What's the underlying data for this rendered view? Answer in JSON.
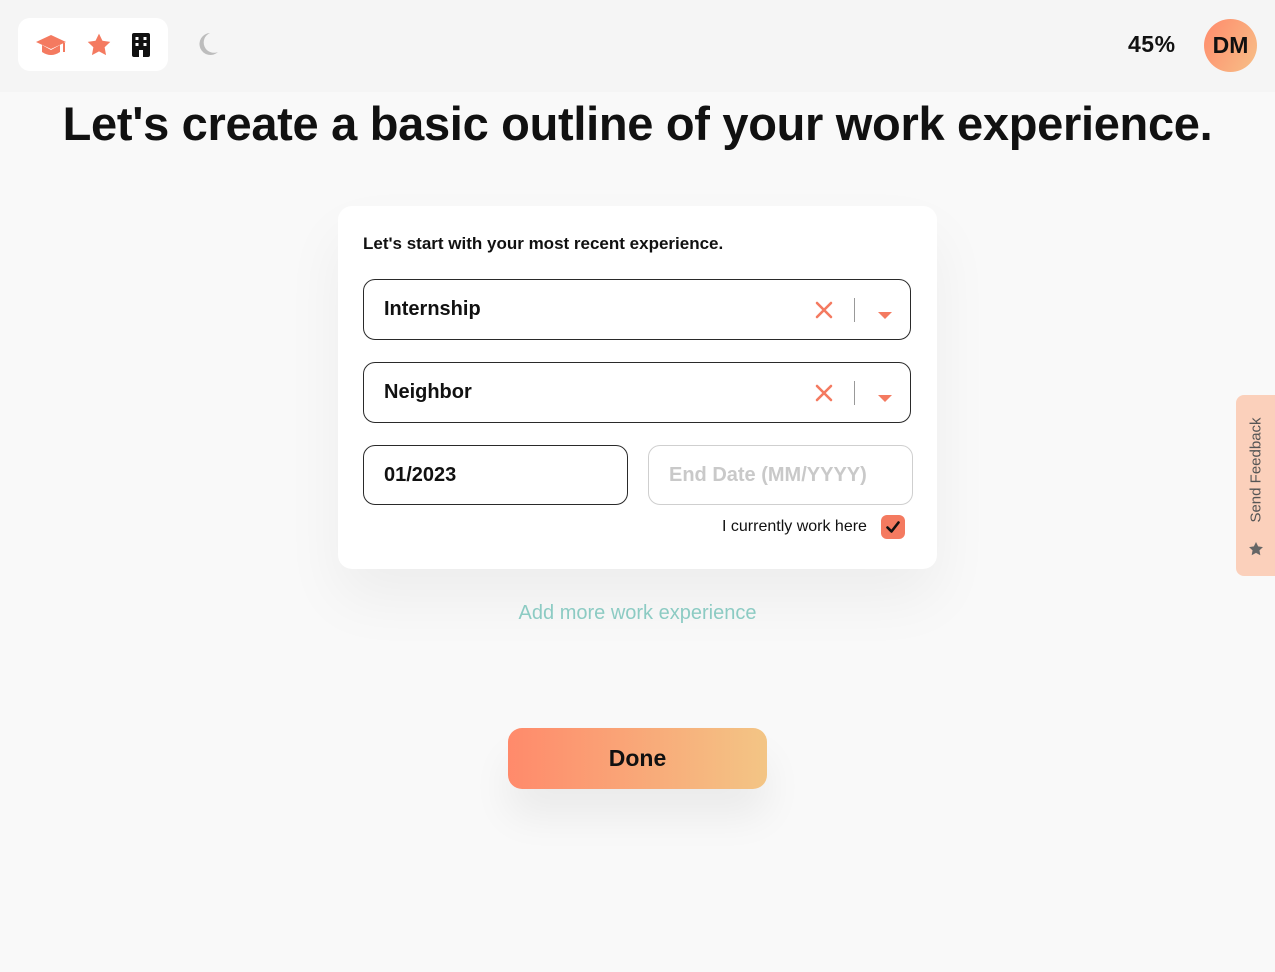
{
  "header": {
    "icons": [
      "graduation-cap-icon",
      "star-icon",
      "building-icon"
    ],
    "theme_icon": "moon-icon",
    "progress": "45%",
    "avatar_initials": "DM"
  },
  "main": {
    "title": "Let's create a basic outline of your work experience."
  },
  "card": {
    "heading": "Let's start with your most recent experience.",
    "type_select": {
      "value": "Internship"
    },
    "company_select": {
      "value": "Neighbor"
    },
    "start_date": {
      "value": "01/2023"
    },
    "end_date": {
      "placeholder": "End Date (MM/YYYY)",
      "value": ""
    },
    "current_checkbox": {
      "label": "I currently work here",
      "checked": true
    }
  },
  "add_more_label": "Add more work experience",
  "done_label": "Done",
  "feedback_label": "Send Feedback",
  "colors": {
    "accent": "#f47a60",
    "link": "#8ccbc3",
    "gradient_start": "#ff8a6b",
    "gradient_end": "#f3c585"
  }
}
